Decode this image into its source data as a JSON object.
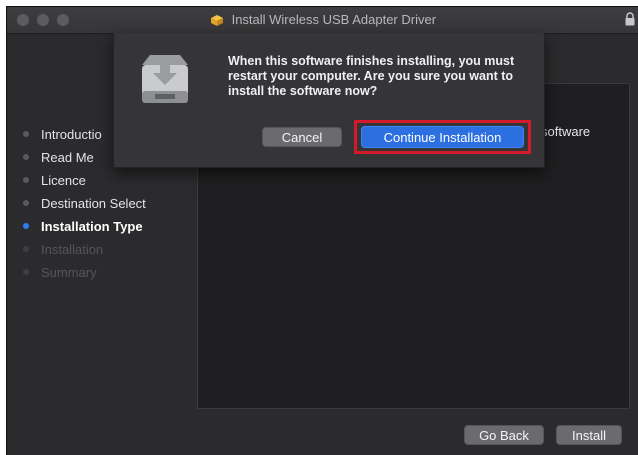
{
  "window": {
    "title": "Install Wireless USB Adapter Driver",
    "title_icon": "installer-package-icon"
  },
  "sidebar": {
    "steps": [
      {
        "label": "Introductio",
        "state": "done"
      },
      {
        "label": "Read Me",
        "state": "done"
      },
      {
        "label": "Licence",
        "state": "done"
      },
      {
        "label": "Destination Select",
        "state": "done"
      },
      {
        "label": "Installation Type",
        "state": "current"
      },
      {
        "label": "Installation",
        "state": "todo"
      },
      {
        "label": "Summary",
        "state": "todo"
      }
    ]
  },
  "content": {
    "partial_text": "software"
  },
  "footer": {
    "go_back_label": "Go Back",
    "install_label": "Install"
  },
  "dialog": {
    "message": "When this software finishes installing, you must restart your computer. Are you sure you want to install the software now?",
    "cancel_label": "Cancel",
    "continue_label": "Continue Installation",
    "icon": "disk-drive-icon",
    "highlight_color": "#d21a2b"
  },
  "colors": {
    "accent": "#2c6fe0",
    "current_step_dot": "#2f7cf6"
  }
}
